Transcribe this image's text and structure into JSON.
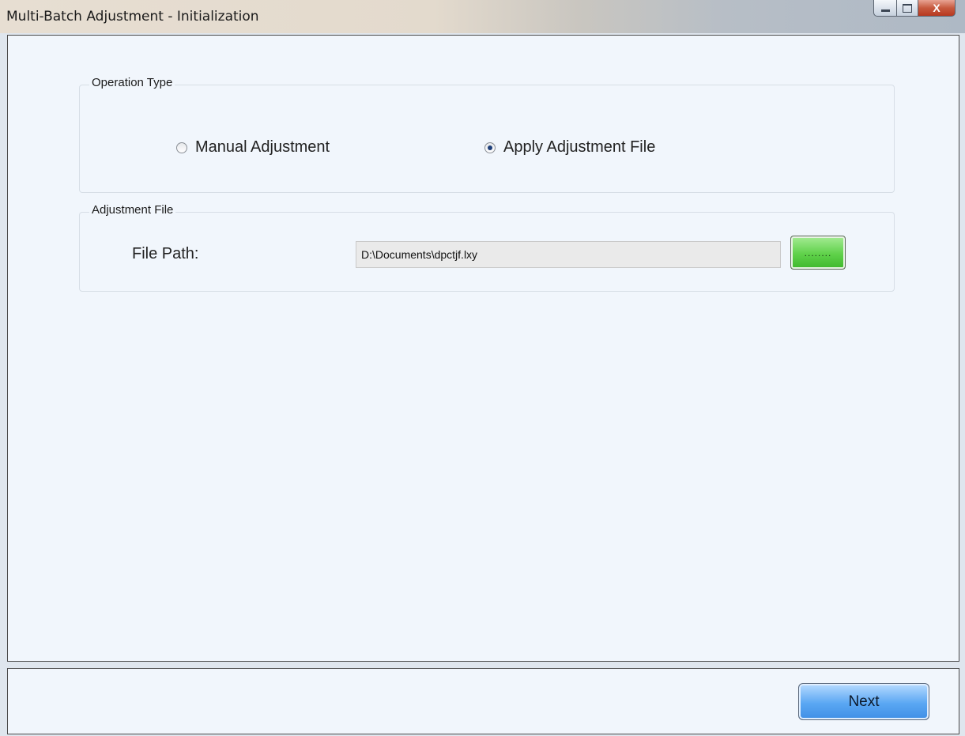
{
  "window": {
    "title": "Multi-Batch Adjustment - Initialization",
    "close_glyph": "X"
  },
  "operation_type": {
    "legend": "Operation Type",
    "options": [
      {
        "label": "Manual Adjustment",
        "checked": false
      },
      {
        "label": "Apply Adjustment File",
        "checked": true
      }
    ]
  },
  "adjustment_file": {
    "legend": "Adjustment File",
    "file_path_label": "File Path:",
    "file_path_value": "D:\\Documents\\dpctjf.lxy",
    "browse_label": "........"
  },
  "footer": {
    "next_label": "Next"
  },
  "colors": {
    "client_bg": "#f1f6fc",
    "browse_button": "#5fd14a",
    "next_button": "#5aa7f3",
    "close_button": "#c75a3f"
  },
  "icons": [
    "minimize-icon",
    "maximize-icon",
    "close-icon"
  ]
}
